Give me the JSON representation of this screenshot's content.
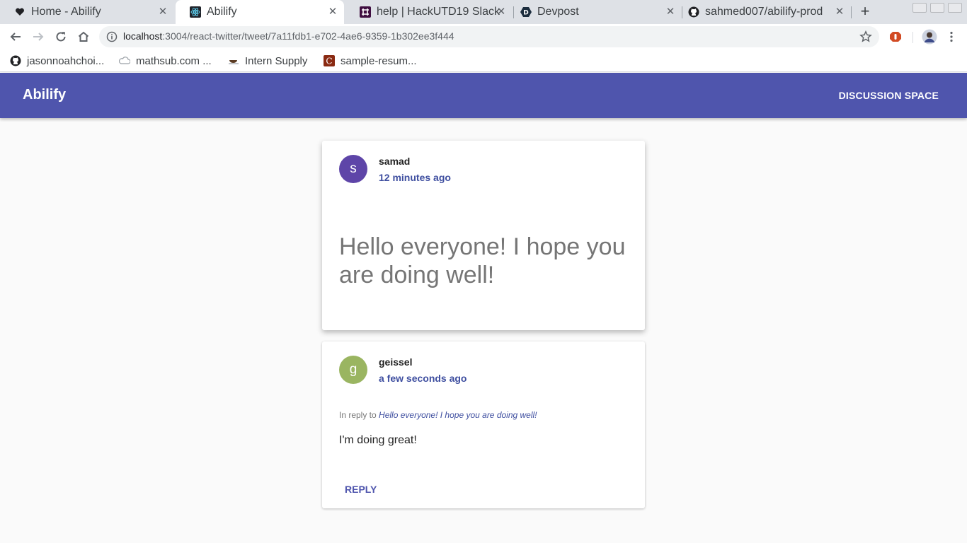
{
  "browser": {
    "tabs": [
      {
        "title": "Home - Abilify",
        "icon": "heart-icon"
      },
      {
        "title": "Abilify",
        "icon": "react-icon"
      },
      {
        "title": "help | HackUTD19 Slack",
        "icon": "slack-icon"
      },
      {
        "title": "Devpost",
        "icon": "devpost-icon"
      },
      {
        "title": "sahmed007/abilify-prod",
        "icon": "github-icon"
      }
    ],
    "active_tab": 1,
    "close_glyph": "✕",
    "new_tab_glyph": "+",
    "url_host": "localhost",
    "url_rest": ":3004/react-twitter/tweet/7a11fdb1-e702-4ae6-9359-1b302ee3f444",
    "bookmarks": [
      {
        "label": "jasonnoahchoi...",
        "icon": "github-icon"
      },
      {
        "label": "mathsub.com ...",
        "icon": "cloud-icon"
      },
      {
        "label": "Intern Supply",
        "icon": "coffee-icon"
      },
      {
        "label": "sample-resum...",
        "icon": "c-icon"
      }
    ]
  },
  "app": {
    "brand": "Abilify",
    "nav_link": "DISCUSSION SPACE",
    "colors": {
      "primary": "#4f55ad",
      "link": "#3f4fa0"
    }
  },
  "tweet": {
    "avatar_letter": "s",
    "avatar_color": "#5e45a8",
    "username": "samad",
    "time": "12 minutes ago",
    "text": "Hello everyone! I hope you are doing well!"
  },
  "reply": {
    "avatar_letter": "g",
    "avatar_color": "#9ab561",
    "username": "geissel",
    "time": "a few seconds ago",
    "in_reply_prefix": "In reply to",
    "in_reply_quote": "Hello everyone! I hope you are doing well!",
    "text": "I'm doing great!",
    "reply_button": "REPLY"
  }
}
